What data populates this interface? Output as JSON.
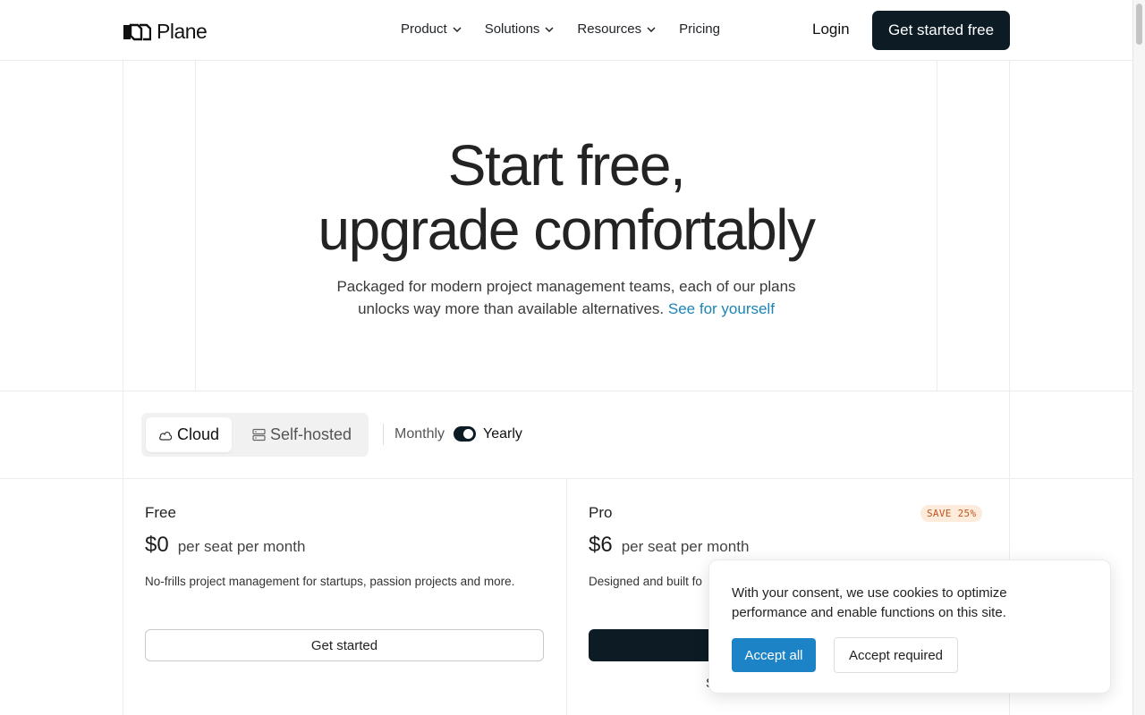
{
  "header": {
    "logo_text": "Plane",
    "nav": [
      {
        "label": "Product",
        "has_dropdown": true
      },
      {
        "label": "Solutions",
        "has_dropdown": true
      },
      {
        "label": "Resources",
        "has_dropdown": true
      },
      {
        "label": "Pricing",
        "has_dropdown": false
      }
    ],
    "login_label": "Login",
    "cta_label": "Get started free"
  },
  "hero": {
    "title_line1": "Start free,",
    "title_line2": "upgrade comfortably",
    "subtitle_line1": "Packaged for modern project management teams, each of our plans",
    "subtitle_line2": "unlocks way more than available alternatives.",
    "subtitle_link": "See for yourself"
  },
  "toggle": {
    "hosting_options": [
      {
        "label": "Cloud",
        "icon": "cloud-icon",
        "selected": true
      },
      {
        "label": "Self-hosted",
        "icon": "server-icon",
        "selected": false
      }
    ],
    "billing_monthly": "Monthly",
    "billing_yearly": "Yearly",
    "billing_selected": "Yearly"
  },
  "plans": [
    {
      "name": "Free",
      "price": "$0",
      "unit": "per seat per month",
      "description": "No-frills project management for startups, passion projects and more.",
      "button_label": "Get started"
    },
    {
      "name": "Pro",
      "badge": "SAVE 25%",
      "price": "$6",
      "unit": "per seat per month",
      "description": "Designed and built fo",
      "peek_text": "S"
    }
  ],
  "cookie": {
    "text": "With your consent, we use cookies to optimize performance and enable functions on this site.",
    "accept_all": "Accept all",
    "accept_required": "Accept required"
  },
  "colors": {
    "dark": "#0d1b24",
    "link": "#1c84b5",
    "accept": "#1c84c6",
    "badge_bg": "#fdebdc",
    "badge_text": "#c2561f"
  }
}
